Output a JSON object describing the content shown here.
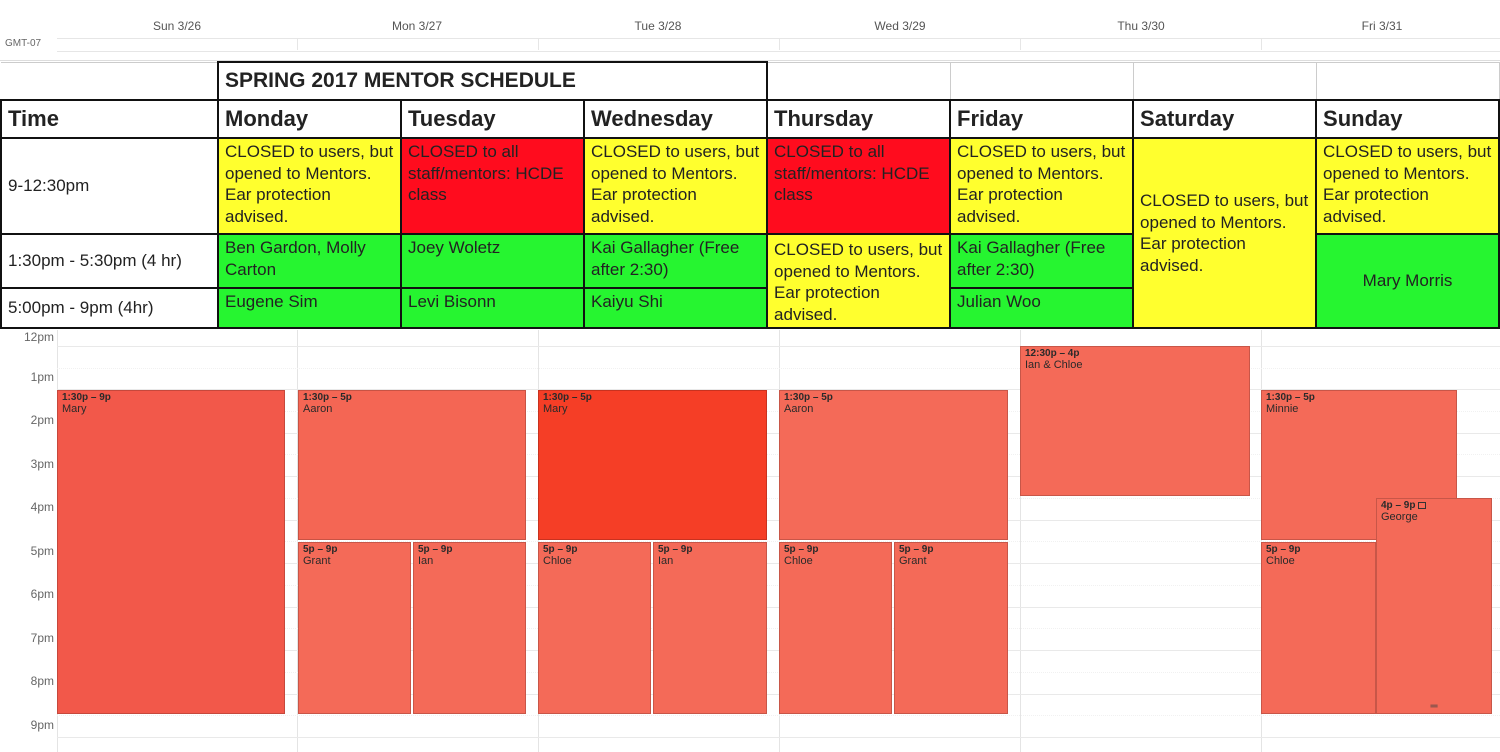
{
  "calendar": {
    "timezone": "GMT-07",
    "days": [
      "Sun 3/26",
      "Mon 3/27",
      "Tue 3/28",
      "Wed 3/29",
      "Thu 3/30",
      "Fri 3/31"
    ],
    "hours": [
      "12pm",
      "1pm",
      "2pm",
      "3pm",
      "4pm",
      "5pm",
      "6pm",
      "7pm",
      "8pm",
      "9pm"
    ],
    "colors": {
      "event": "#f2584a",
      "event_light": "#f46a58",
      "event_selected": "#f53e26"
    },
    "events": [
      {
        "time": "1:30p – 9p",
        "name": "Mary"
      },
      {
        "time": "1:30p – 5p",
        "name": "Aaron"
      },
      {
        "time": "5p – 9p",
        "name": "Grant"
      },
      {
        "time": "5p – 9p",
        "name": "Ian"
      },
      {
        "time": "1:30p – 5p",
        "name": "Mary"
      },
      {
        "time": "5p – 9p",
        "name": "Chloe"
      },
      {
        "time": "5p – 9p",
        "name": "Ian"
      },
      {
        "time": "1:30p – 5p",
        "name": "Aaron"
      },
      {
        "time": "5p – 9p",
        "name": "Chloe"
      },
      {
        "time": "5p – 9p",
        "name": "Grant"
      },
      {
        "time": "12:30p – 4p",
        "name": "Ian & Chloe"
      },
      {
        "time": "1:30p – 5p",
        "name": "Minnie"
      },
      {
        "time": "5p – 9p",
        "name": "Chloe"
      },
      {
        "time": "4p – 9p",
        "name": "George"
      }
    ]
  },
  "schedule": {
    "title": "SPRING 2017 MENTOR SCHEDULE",
    "headers": [
      "Time",
      "Monday",
      "Tuesday",
      "Wednesday",
      "Thursday",
      "Friday",
      "Saturday",
      "Sunday"
    ],
    "colors": {
      "closed_users": "#ffff2e",
      "closed_all": "#ff0c1e",
      "staffed": "#26f530"
    },
    "row1": {
      "time": "9-12:30pm",
      "mon": "CLOSED to users, but opened to Mentors. Ear protection advised.",
      "tue": "CLOSED to all staff/mentors: HCDE class",
      "wed": "CLOSED to users, but opened to Mentors. Ear protection advised.",
      "thu": "CLOSED to all staff/mentors: HCDE class",
      "fri": "CLOSED to users, but opened to Mentors. Ear protection advised.",
      "sat": "CLOSED to users, but opened to Mentors. Ear protection advised.",
      "sun": "CLOSED to users, but opened to Mentors. Ear protection advised."
    },
    "row2": {
      "time": "1:30pm - 5:30pm (4 hr)",
      "mon": "Ben Gardon, Molly Carton",
      "tue": "Joey Woletz",
      "wed": "Kai Gallagher (Free after 2:30)",
      "thu": "CLOSED to users, but opened to Mentors. Ear protection advised.",
      "fri": "Kai Gallagher (Free after 2:30)",
      "sun": "Mary Morris"
    },
    "row3": {
      "time": "5:00pm - 9pm (4hr)",
      "mon": "Eugene Sim",
      "tue": "Levi Bisonn",
      "wed": "Kaiyu Shi",
      "fri": "Julian Woo"
    }
  }
}
